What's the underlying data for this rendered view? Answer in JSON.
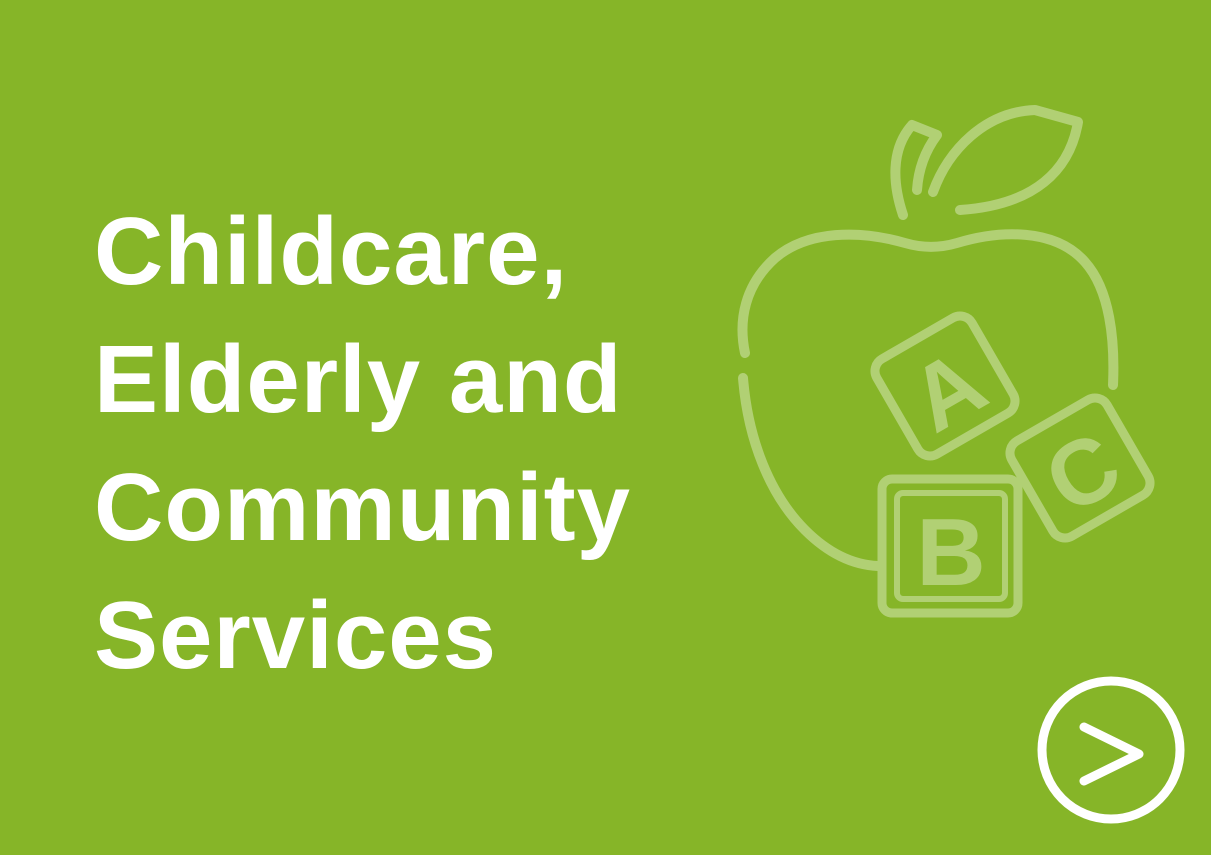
{
  "tile": {
    "background_color": "#86b528",
    "title_lines": [
      "Childcare,",
      "Elderly and",
      "Community",
      "Services"
    ],
    "title_color": "#ffffff"
  },
  "illustration": {
    "icon": "apple-abc-blocks-icon",
    "stroke_color": "#b1d074",
    "block_letters": [
      "A",
      "B",
      "C"
    ]
  },
  "next_button": {
    "icon": "chevron-right-circle-icon",
    "color": "#ffffff"
  }
}
